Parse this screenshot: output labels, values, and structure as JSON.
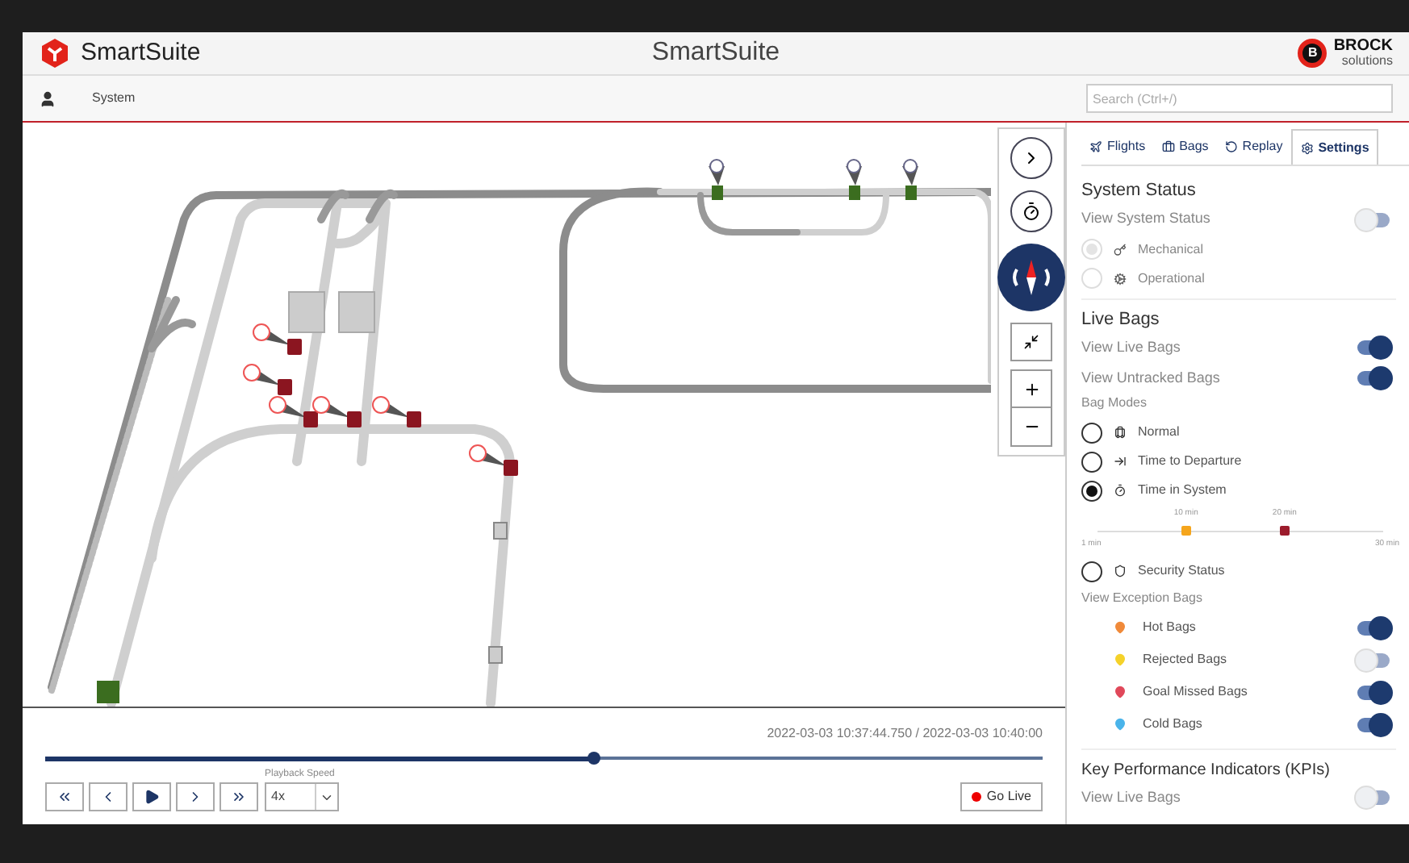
{
  "header": {
    "app_name": "SmartSuite",
    "title": "SmartSuite",
    "brand_name": "BROCK",
    "brand_sub": "solutions",
    "brand_badge": "B"
  },
  "nav": {
    "breadcrumb": "System",
    "search_placeholder": "Search (Ctrl+/)"
  },
  "playback": {
    "timestamp": "2022-03-03 10:37:44.750 / 2022-03-03 10:40:00",
    "level": 0.55,
    "speed_label": "Playback Speed",
    "speed_value": "4x",
    "go_live": "Go Live"
  },
  "tabs": [
    {
      "label": "Flights",
      "selected": false
    },
    {
      "label": "Bags",
      "selected": false
    },
    {
      "label": "Replay",
      "selected": false
    },
    {
      "label": "Settings",
      "selected": true
    }
  ],
  "system_status": {
    "title": "System Status",
    "toggle_label": "View System Status",
    "on": false,
    "options": [
      {
        "label": "Mechanical",
        "selected": true,
        "disabled": true
      },
      {
        "label": "Operational",
        "selected": false,
        "disabled": true
      }
    ]
  },
  "live_bags": {
    "title": "Live Bags",
    "toggles": [
      {
        "label": "View Live Bags",
        "on": true
      },
      {
        "label": "View Untracked Bags",
        "on": true
      }
    ],
    "modes_label": "Bag Modes",
    "modes": [
      {
        "label": "Normal",
        "selected": false,
        "kind": "plain"
      },
      {
        "label": "Time to Departure",
        "selected": false,
        "kind": "plain"
      },
      {
        "label": "Time in System",
        "selected": true,
        "kind": "slider"
      },
      {
        "label": "Security Status",
        "selected": false,
        "kind": "plain"
      }
    ],
    "slider": {
      "min_label": "1 min",
      "max_label": "30 min",
      "thumbs": [
        {
          "label": "10 min",
          "level": 0.31,
          "color": "#f5a51c"
        },
        {
          "label": "20 min",
          "level": 0.655,
          "color": "#9c1c2c"
        }
      ]
    },
    "exception_label": "View Exception Bags",
    "exceptions": [
      {
        "label": "Hot Bags",
        "color": "#f08a3a",
        "on": true
      },
      {
        "label": "Rejected Bags",
        "color": "#f5d22a",
        "on": false
      },
      {
        "label": "Goal Missed Bags",
        "color": "#e0485a",
        "on": true
      },
      {
        "label": "Cold Bags",
        "color": "#4ab4ea",
        "on": true
      }
    ]
  },
  "kpis": {
    "title": "Key Performance Indicators (KPIs)",
    "toggles": [
      {
        "label": "View Live Bags",
        "on": false
      }
    ]
  }
}
